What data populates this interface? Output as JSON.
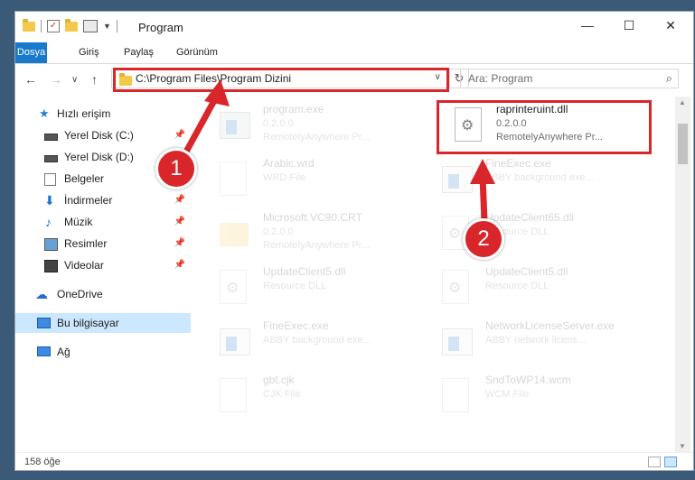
{
  "window": {
    "title": "Program",
    "controls": {
      "minimize": "—",
      "maximize": "☐",
      "close": "✕"
    }
  },
  "ribbon": {
    "tabs": [
      {
        "label": "Dosya"
      },
      {
        "label": "Giriş"
      },
      {
        "label": "Paylaş"
      },
      {
        "label": "Görünüm"
      }
    ]
  },
  "address": {
    "path": "C:\\Program Files\\Program Dizini",
    "search_placeholder": "Ara: Program"
  },
  "sidebar": {
    "items": [
      {
        "label": "Hızlı erişim",
        "icon": "star-icon"
      },
      {
        "label": "Yerel Disk (C:)",
        "icon": "drive-icon"
      },
      {
        "label": "Yerel Disk (D:)",
        "icon": "drive-icon"
      },
      {
        "label": "Belgeler",
        "icon": "documents-icon"
      },
      {
        "label": "İndirmeler",
        "icon": "download-icon"
      },
      {
        "label": "Müzik",
        "icon": "music-icon"
      },
      {
        "label": "Resimler",
        "icon": "pictures-icon"
      },
      {
        "label": "Videolar",
        "icon": "video-icon"
      },
      {
        "label": "OneDrive",
        "icon": "cloud-icon"
      },
      {
        "label": "Bu bilgisayar",
        "icon": "computer-icon"
      },
      {
        "label": "Ağ",
        "icon": "network-icon"
      }
    ]
  },
  "files": [
    {
      "name": "program.exe",
      "line1": "0.2.0.0",
      "line2": "RemotelyAnywhere Pr...",
      "icon": "installer-icon"
    },
    {
      "name": "raprinteruint.dll",
      "line1": "0.2.0.0",
      "line2": "RemotelyAnywhere Pr...",
      "icon": "dll-file-icon"
    },
    {
      "name": "Arabic.wrd",
      "line1": "WRD File",
      "line2": "",
      "icon": "document-icon"
    },
    {
      "name": "FineExec.exe",
      "line1": "ABBY background exe...",
      "line2": "",
      "icon": "app-window-icon"
    },
    {
      "name": "Microsoft.VC90.CRT",
      "line1": "0.2.0.0",
      "line2": "RemotelyAnywhere Pr...",
      "icon": "folder-icon"
    },
    {
      "name": "UpdateClient65.dll",
      "line1": "Resource DLL",
      "line2": "",
      "icon": "dll-file-icon"
    },
    {
      "name": "UpdateClient5.dll",
      "line1": "Resource DLL",
      "line2": "",
      "icon": "dll-file-icon"
    },
    {
      "name": "UpdateClient5.dll",
      "line1": "Resource DLL",
      "line2": "",
      "icon": "dll-file-icon"
    },
    {
      "name": "FineExec.exe",
      "line1": "ABBY background exe...",
      "line2": "",
      "icon": "app-window-icon"
    },
    {
      "name": "NetworkLicenseServer.exe",
      "line1": "ABBY network licens...",
      "line2": "",
      "icon": "app-window-icon"
    },
    {
      "name": "gbt.cjk",
      "line1": "CJK File",
      "line2": "",
      "icon": "document-icon"
    },
    {
      "name": "SndToWP14.wcm",
      "line1": "WCM File",
      "line2": "",
      "icon": "document-icon"
    }
  ],
  "status": {
    "count": "158 öğe"
  },
  "annotations": [
    {
      "label": "1"
    },
    {
      "label": "2"
    }
  ],
  "colors": {
    "accent": "#1979ca",
    "highlight": "#d8262b",
    "selection": "#cce8ff"
  }
}
